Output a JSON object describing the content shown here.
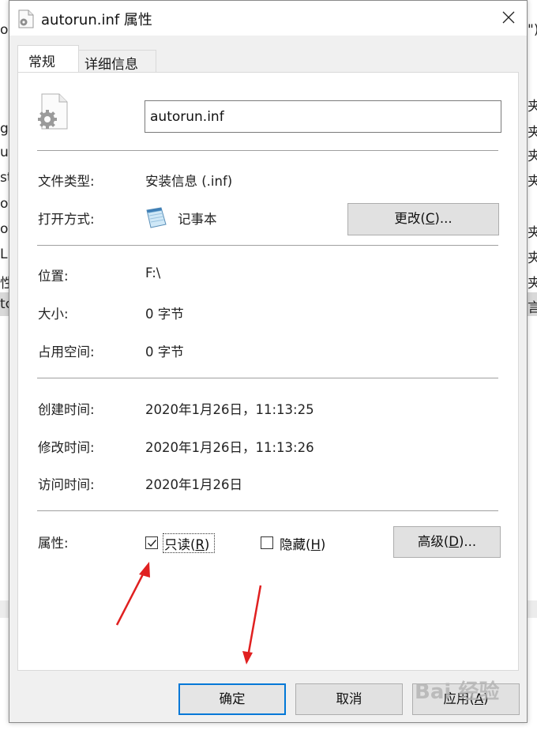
{
  "background": {
    "left_fragments": [
      "on",
      "g",
      "us",
      "st",
      "ot",
      "ot",
      "L",
      "性",
      "tc"
    ],
    "right_fragments": [
      "\")",
      "夹",
      "夹",
      "夹",
      "夹",
      "夹",
      "夹",
      "夹",
      "言"
    ]
  },
  "dialog": {
    "title": "autorun.inf 属性",
    "close_icon": "close-icon"
  },
  "tabs": [
    {
      "label": "常规",
      "active": true
    },
    {
      "label": "详细信息",
      "active": false
    }
  ],
  "general": {
    "file_name": "autorun.inf",
    "file_icon": "settings-file-icon",
    "file_type_label": "文件类型:",
    "file_type_value": "安装信息 (.inf)",
    "open_with_label": "打开方式:",
    "open_with_value": "记事本",
    "open_with_icon": "notepad-icon",
    "change_button": {
      "text": "更改(",
      "key": "C",
      "suffix": ")..."
    },
    "location_label": "位置:",
    "location_value": "F:\\",
    "size_label": "大小:",
    "size_value": "0 字节",
    "size_on_disk_label": "占用空间:",
    "size_on_disk_value": "0 字节",
    "created_label": "创建时间:",
    "created_value": "2020年1月26日，11:13:25",
    "modified_label": "修改时间:",
    "modified_value": "2020年1月26日，11:13:26",
    "accessed_label": "访问时间:",
    "accessed_value": "2020年1月26日",
    "attributes_label": "属性:",
    "readonly": {
      "text": "只读(",
      "key": "R",
      "suffix": ")",
      "checked": true
    },
    "hidden": {
      "text": "隐藏(",
      "key": "H",
      "suffix": ")",
      "checked": false
    },
    "advanced_button": {
      "text": "高级(",
      "key": "D",
      "suffix": ")..."
    }
  },
  "footer": {
    "ok": "确定",
    "cancel": "取消",
    "apply": {
      "text": "应用(",
      "key": "A",
      "suffix": ")"
    }
  },
  "annotations": {
    "arrow_color": "#e02020"
  },
  "watermark": {
    "text": "Bai 经验"
  }
}
